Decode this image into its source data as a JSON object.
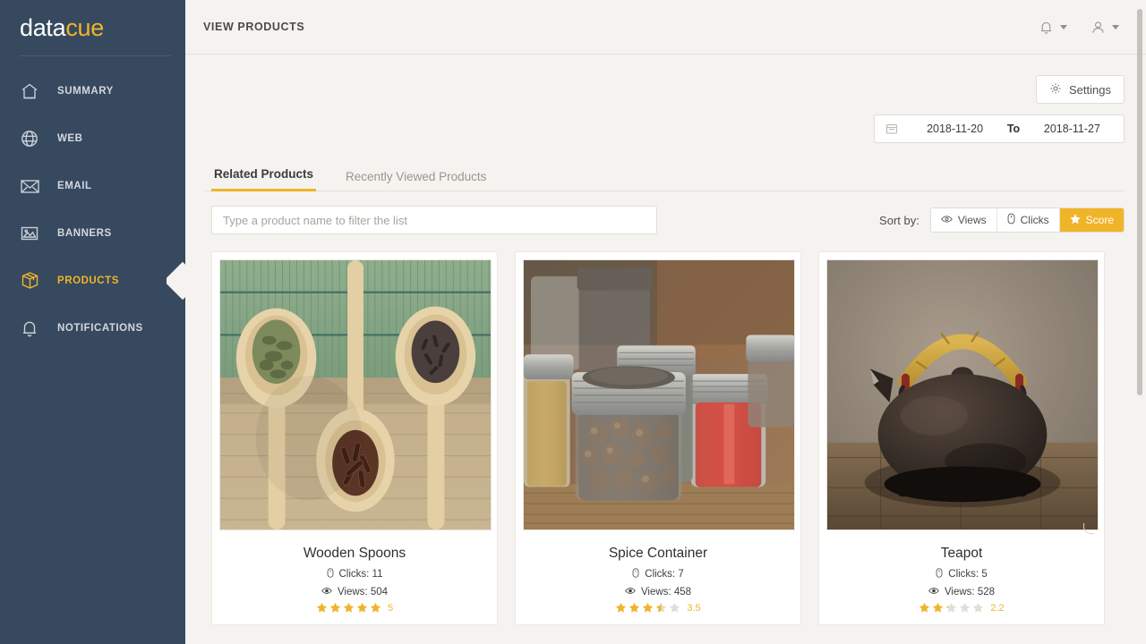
{
  "sidebar": {
    "logo": {
      "part1": "data",
      "part2": "cue"
    },
    "items": [
      {
        "label": "SUMMARY",
        "icon": "home-icon",
        "active": false
      },
      {
        "label": "WEB",
        "icon": "globe-icon",
        "active": false
      },
      {
        "label": "EMAIL",
        "icon": "envelope-icon",
        "active": false
      },
      {
        "label": "BANNERS",
        "icon": "image-icon",
        "active": false
      },
      {
        "label": "PRODUCTS",
        "icon": "box-icon",
        "active": true
      },
      {
        "label": "NOTIFICATIONS",
        "icon": "bell-icon",
        "active": false
      }
    ]
  },
  "header": {
    "title": "VIEW PRODUCTS",
    "notifications_icon": "bell-icon",
    "account_icon": "user-icon"
  },
  "toolbar": {
    "settings_label": "Settings",
    "settings_icon": "gear-icon"
  },
  "date_range": {
    "calendar_icon": "calendar-icon",
    "from": "2018-11-20",
    "separator": "To",
    "to": "2018-11-27"
  },
  "tabs": [
    {
      "label": "Related Products",
      "active": true
    },
    {
      "label": "Recently Viewed Products",
      "active": false
    }
  ],
  "filter": {
    "placeholder": "Type a product name to filter the list",
    "value": ""
  },
  "sort": {
    "label": "Sort by:",
    "options": [
      {
        "label": "Views",
        "icon": "eye-icon",
        "active": false
      },
      {
        "label": "Clicks",
        "icon": "mouse-icon",
        "active": false
      },
      {
        "label": "Score",
        "icon": "star-icon",
        "active": true
      }
    ]
  },
  "products": [
    {
      "name": "Wooden Spoons",
      "image": "wooden-spoons-photo",
      "clicks_label": "Clicks: 11",
      "views_label": "Views: 504",
      "clicks": 11,
      "views": 504,
      "rating": 5,
      "rating_label": "5"
    },
    {
      "name": "Spice Container",
      "image": "spice-container-photo",
      "clicks_label": "Clicks: 7",
      "views_label": "Views: 458",
      "clicks": 7,
      "views": 458,
      "rating": 3.5,
      "rating_label": "3.5"
    },
    {
      "name": "Teapot",
      "image": "teapot-photo",
      "clicks_label": "Clicks: 5",
      "views_label": "Views: 528",
      "clicks": 5,
      "views": 528,
      "rating": 2.2,
      "rating_label": "2.2"
    }
  ],
  "colors": {
    "sidebar_bg": "#36495e",
    "accent": "#f0b429",
    "page_bg": "#f5f3ef",
    "card_bg": "#ffffff",
    "star_filled": "#f0b429",
    "star_empty": "#e2ded6"
  }
}
